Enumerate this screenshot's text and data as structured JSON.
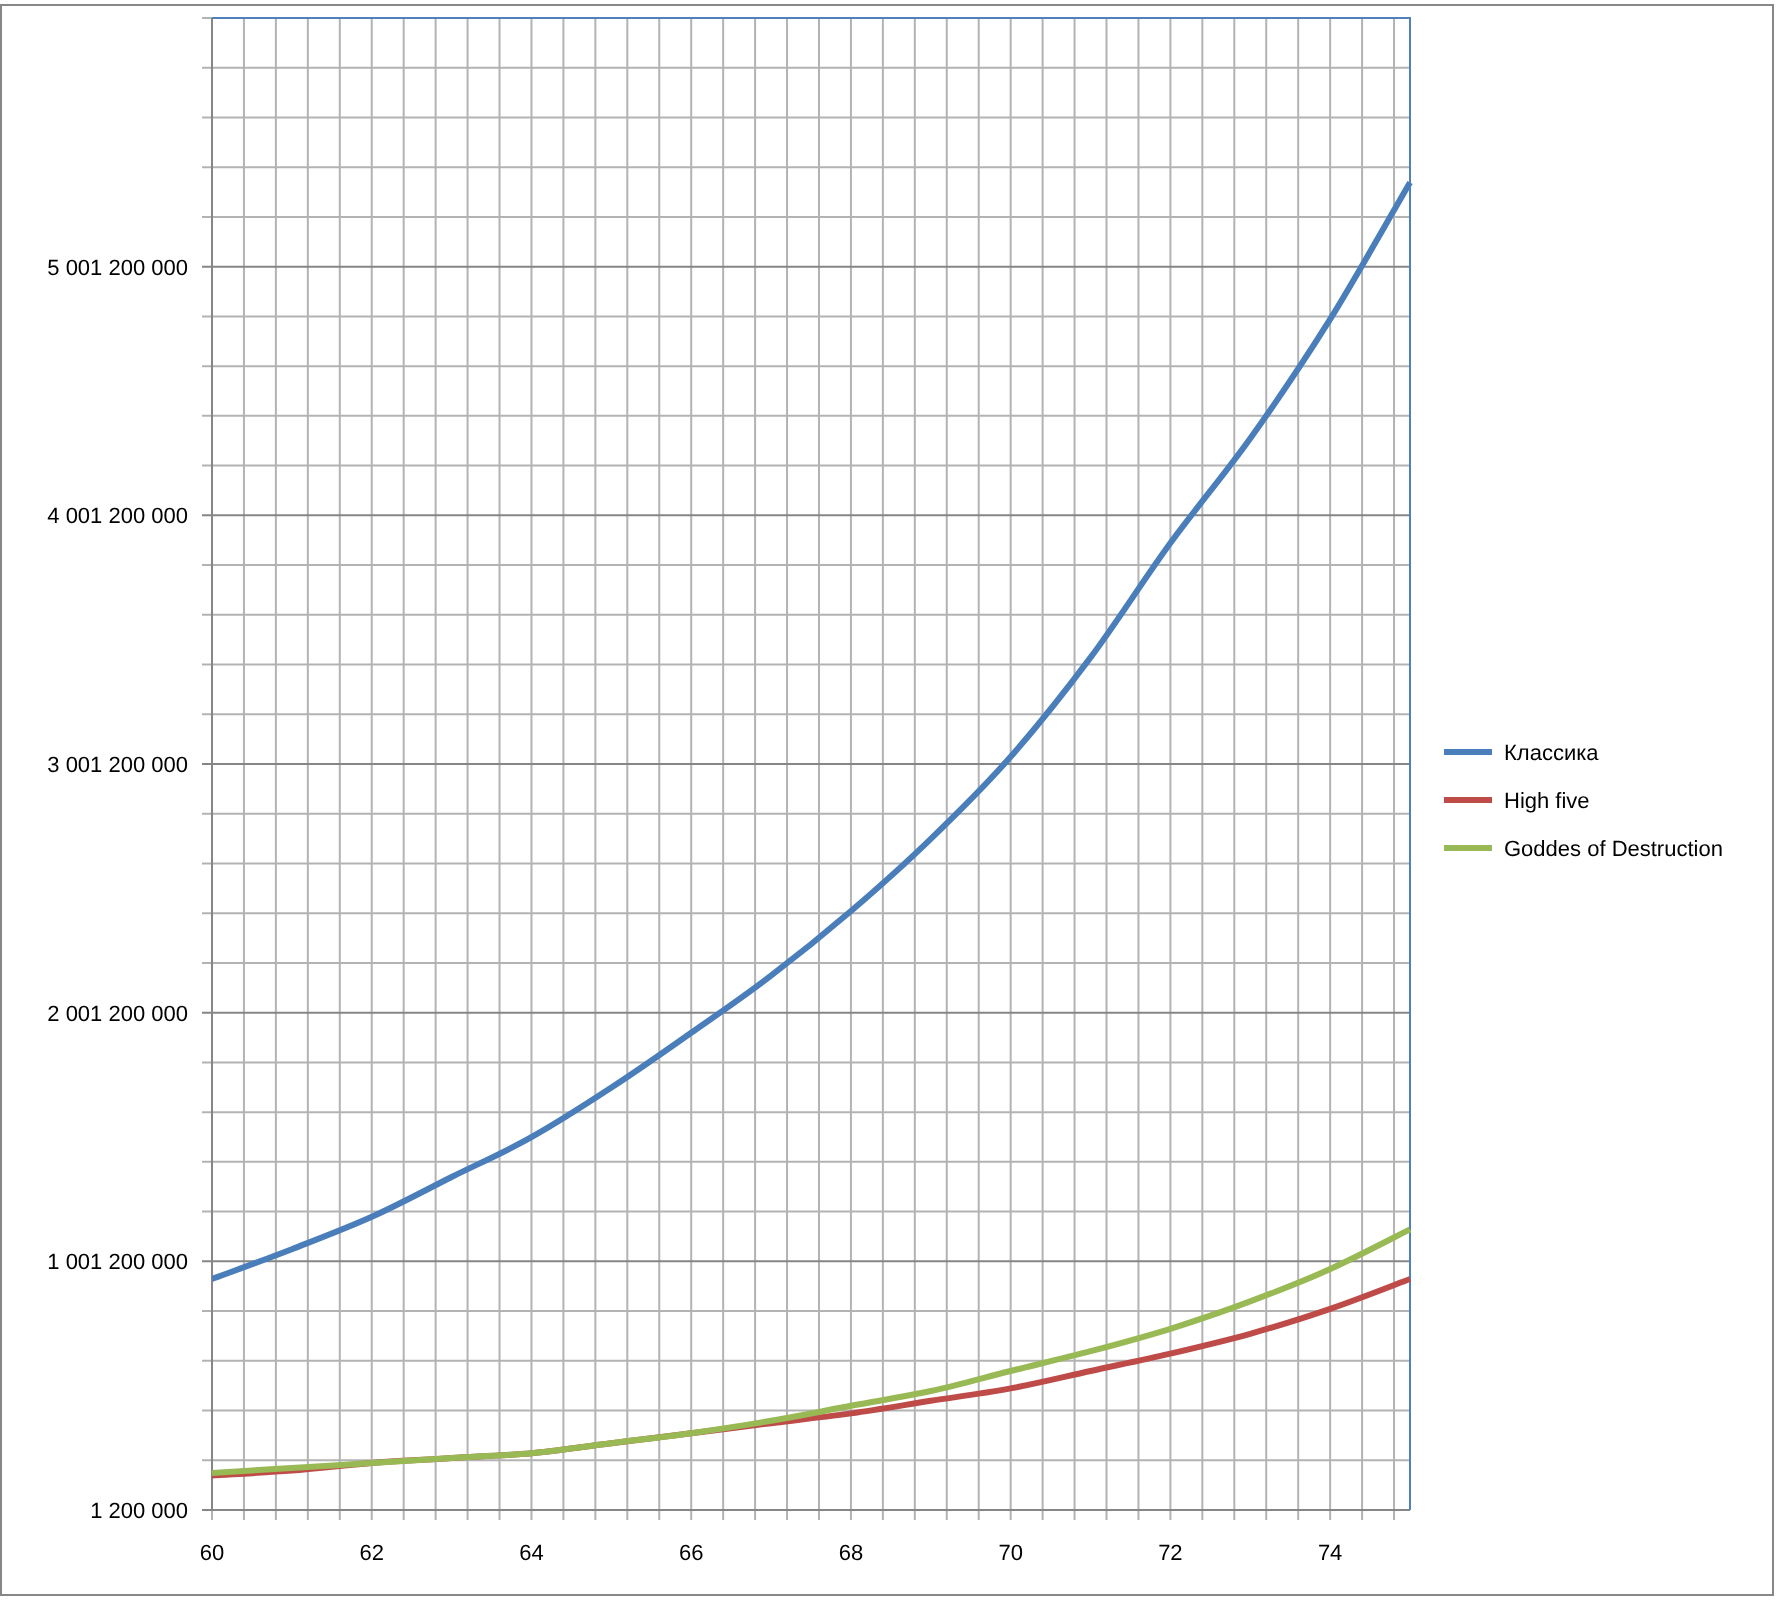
{
  "chart_data": {
    "type": "line",
    "x": [
      60,
      61,
      62,
      63,
      64,
      65,
      66,
      67,
      68,
      69,
      70,
      71,
      72,
      73,
      74,
      75
    ],
    "series": [
      {
        "name": "Классика",
        "color": "#4a7ebb",
        "values": [
          930000000,
          1050000000,
          1180000000,
          1340000000,
          1500000000,
          1700000000,
          1920000000,
          2150000000,
          2410000000,
          2700000000,
          3030000000,
          3430000000,
          3890000000,
          4310000000,
          4790000000,
          5340000000
        ]
      },
      {
        "name": "High five",
        "color": "#be4b48",
        "values": [
          140000000,
          160000000,
          190000000,
          210000000,
          230000000,
          270000000,
          310000000,
          350000000,
          390000000,
          440000000,
          490000000,
          560000000,
          630000000,
          710000000,
          810000000,
          930000000
        ]
      },
      {
        "name": "Goddes of Destruction",
        "color": "#98b954",
        "values": [
          150000000,
          170000000,
          190000000,
          210000000,
          230000000,
          270000000,
          310000000,
          360000000,
          420000000,
          480000000,
          560000000,
          640000000,
          730000000,
          840000000,
          970000000,
          1130000000
        ]
      }
    ],
    "xlim": [
      60,
      75
    ],
    "ylim": [
      1200000,
      6001200000
    ],
    "xticks": [
      60,
      62,
      64,
      66,
      68,
      70,
      72,
      74
    ],
    "yticks": [
      {
        "value": 1200000,
        "label": "1 200 000"
      },
      {
        "value": 1001200000,
        "label": "1 001 200 000"
      },
      {
        "value": 2001200000,
        "label": "2 001 200 000"
      },
      {
        "value": 3001200000,
        "label": "3 001 200 000"
      },
      {
        "value": 4001200000,
        "label": "4 001 200 000"
      },
      {
        "value": 5001200000,
        "label": "5 001 200 000"
      }
    ],
    "grid": true,
    "legend": true
  }
}
